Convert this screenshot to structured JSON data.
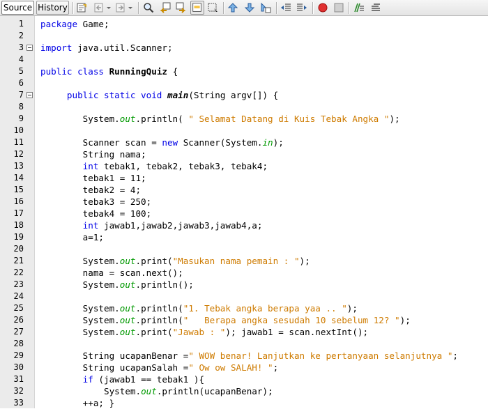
{
  "tabs": {
    "source": "Source",
    "history": "History"
  },
  "toolbar_icons": [
    "last-edit-icon",
    "back-icon",
    "forward-icon",
    "find-icon",
    "find-previous-icon",
    "find-next-icon",
    "toggle-highlight-icon",
    "find-selection-icon",
    "previous-bookmark-icon",
    "next-bookmark-icon",
    "toggle-bookmark-icon",
    "shift-left-icon",
    "shift-right-icon",
    "start-macro-icon",
    "stop-macro-icon",
    "comment-icon",
    "uncomment-icon"
  ],
  "line_numbers": [
    "1",
    "2",
    "3",
    "4",
    "5",
    "6",
    "7",
    "8",
    "9",
    "10",
    "11",
    "12",
    "13",
    "14",
    "15",
    "16",
    "17",
    "18",
    "19",
    "20",
    "21",
    "22",
    "23",
    "24",
    "25",
    "26",
    "27",
    "28",
    "29",
    "30",
    "31",
    "32",
    "33"
  ],
  "colors": {
    "keyword": "#0000e6",
    "string": "#ce7b00",
    "field": "#009900",
    "gutter": "#ebebeb"
  },
  "code": [
    [
      {
        "t": "package",
        "k": "kw"
      },
      {
        "t": " Game;",
        "k": ""
      }
    ],
    [],
    [
      {
        "t": "import",
        "k": "kw"
      },
      {
        "t": " java.util.Scanner;",
        "k": ""
      }
    ],
    [],
    [
      {
        "t": "public class ",
        "k": "kw"
      },
      {
        "t": "RunningQuiz",
        "k": "cls"
      },
      {
        "t": " {",
        "k": ""
      }
    ],
    [],
    [
      {
        "t": "     public static void ",
        "k": "kw"
      },
      {
        "t": "main",
        "k": "meth"
      },
      {
        "t": "(String argv[]) {",
        "k": ""
      }
    ],
    [],
    [
      {
        "t": "        System.",
        "k": ""
      },
      {
        "t": "out",
        "k": "fld"
      },
      {
        "t": ".println( ",
        "k": ""
      },
      {
        "t": "\" Selamat Datang di Kuis Tebak Angka \"",
        "k": "str"
      },
      {
        "t": ");",
        "k": ""
      }
    ],
    [],
    [
      {
        "t": "        Scanner scan = ",
        "k": ""
      },
      {
        "t": "new",
        "k": "kw"
      },
      {
        "t": " Scanner(System.",
        "k": ""
      },
      {
        "t": "in",
        "k": "fld"
      },
      {
        "t": ");",
        "k": ""
      }
    ],
    [
      {
        "t": "        String nama;",
        "k": ""
      }
    ],
    [
      {
        "t": "        ",
        "k": ""
      },
      {
        "t": "int",
        "k": "kw"
      },
      {
        "t": " tebak1, tebak2, tebak3, tebak4;",
        "k": ""
      }
    ],
    [
      {
        "t": "        tebak1 = 11;",
        "k": ""
      }
    ],
    [
      {
        "t": "        tebak2 = 4;",
        "k": ""
      }
    ],
    [
      {
        "t": "        tebak3 = 250;",
        "k": ""
      }
    ],
    [
      {
        "t": "        tebak4 = 100;",
        "k": ""
      }
    ],
    [
      {
        "t": "        ",
        "k": ""
      },
      {
        "t": "int",
        "k": "kw"
      },
      {
        "t": " jawab1,jawab2,jawab3,jawab4,a;",
        "k": ""
      }
    ],
    [
      {
        "t": "        a=1;",
        "k": ""
      }
    ],
    [],
    [
      {
        "t": "        System.",
        "k": ""
      },
      {
        "t": "out",
        "k": "fld"
      },
      {
        "t": ".print(",
        "k": ""
      },
      {
        "t": "\"Masukan nama pemain : \"",
        "k": "str"
      },
      {
        "t": ");",
        "k": ""
      }
    ],
    [
      {
        "t": "        nama = scan.next();",
        "k": ""
      }
    ],
    [
      {
        "t": "        System.",
        "k": ""
      },
      {
        "t": "out",
        "k": "fld"
      },
      {
        "t": ".println();",
        "k": ""
      }
    ],
    [],
    [
      {
        "t": "        System.",
        "k": ""
      },
      {
        "t": "out",
        "k": "fld"
      },
      {
        "t": ".println(",
        "k": ""
      },
      {
        "t": "\"1. Tebak angka berapa yaa .. \"",
        "k": "str"
      },
      {
        "t": ");",
        "k": ""
      }
    ],
    [
      {
        "t": "        System.",
        "k": ""
      },
      {
        "t": "out",
        "k": "fld"
      },
      {
        "t": ".println(",
        "k": ""
      },
      {
        "t": "\"   Berapa angka sesudah 10 sebelum 12? \"",
        "k": "str"
      },
      {
        "t": ");",
        "k": ""
      }
    ],
    [
      {
        "t": "        System.",
        "k": ""
      },
      {
        "t": "out",
        "k": "fld"
      },
      {
        "t": ".print(",
        "k": ""
      },
      {
        "t": "\"Jawab : \"",
        "k": "str"
      },
      {
        "t": "); jawab1 = scan.nextInt();",
        "k": ""
      }
    ],
    [],
    [
      {
        "t": "        String ucapanBenar =",
        "k": ""
      },
      {
        "t": "\" WOW benar! Lanjutkan ke pertanyaan selanjutnya \"",
        "k": "str"
      },
      {
        "t": ";",
        "k": ""
      }
    ],
    [
      {
        "t": "        String ucapanSalah =",
        "k": ""
      },
      {
        "t": "\" Ow ow SALAH! \"",
        "k": "str"
      },
      {
        "t": ";",
        "k": ""
      }
    ],
    [
      {
        "t": "        ",
        "k": ""
      },
      {
        "t": "if",
        "k": "kw"
      },
      {
        "t": " (jawab1 == tebak1 ){",
        "k": ""
      }
    ],
    [
      {
        "t": "            System.",
        "k": ""
      },
      {
        "t": "out",
        "k": "fld"
      },
      {
        "t": ".println(ucapanBenar);",
        "k": ""
      }
    ],
    [
      {
        "t": "        ++a; }",
        "k": ""
      }
    ]
  ]
}
